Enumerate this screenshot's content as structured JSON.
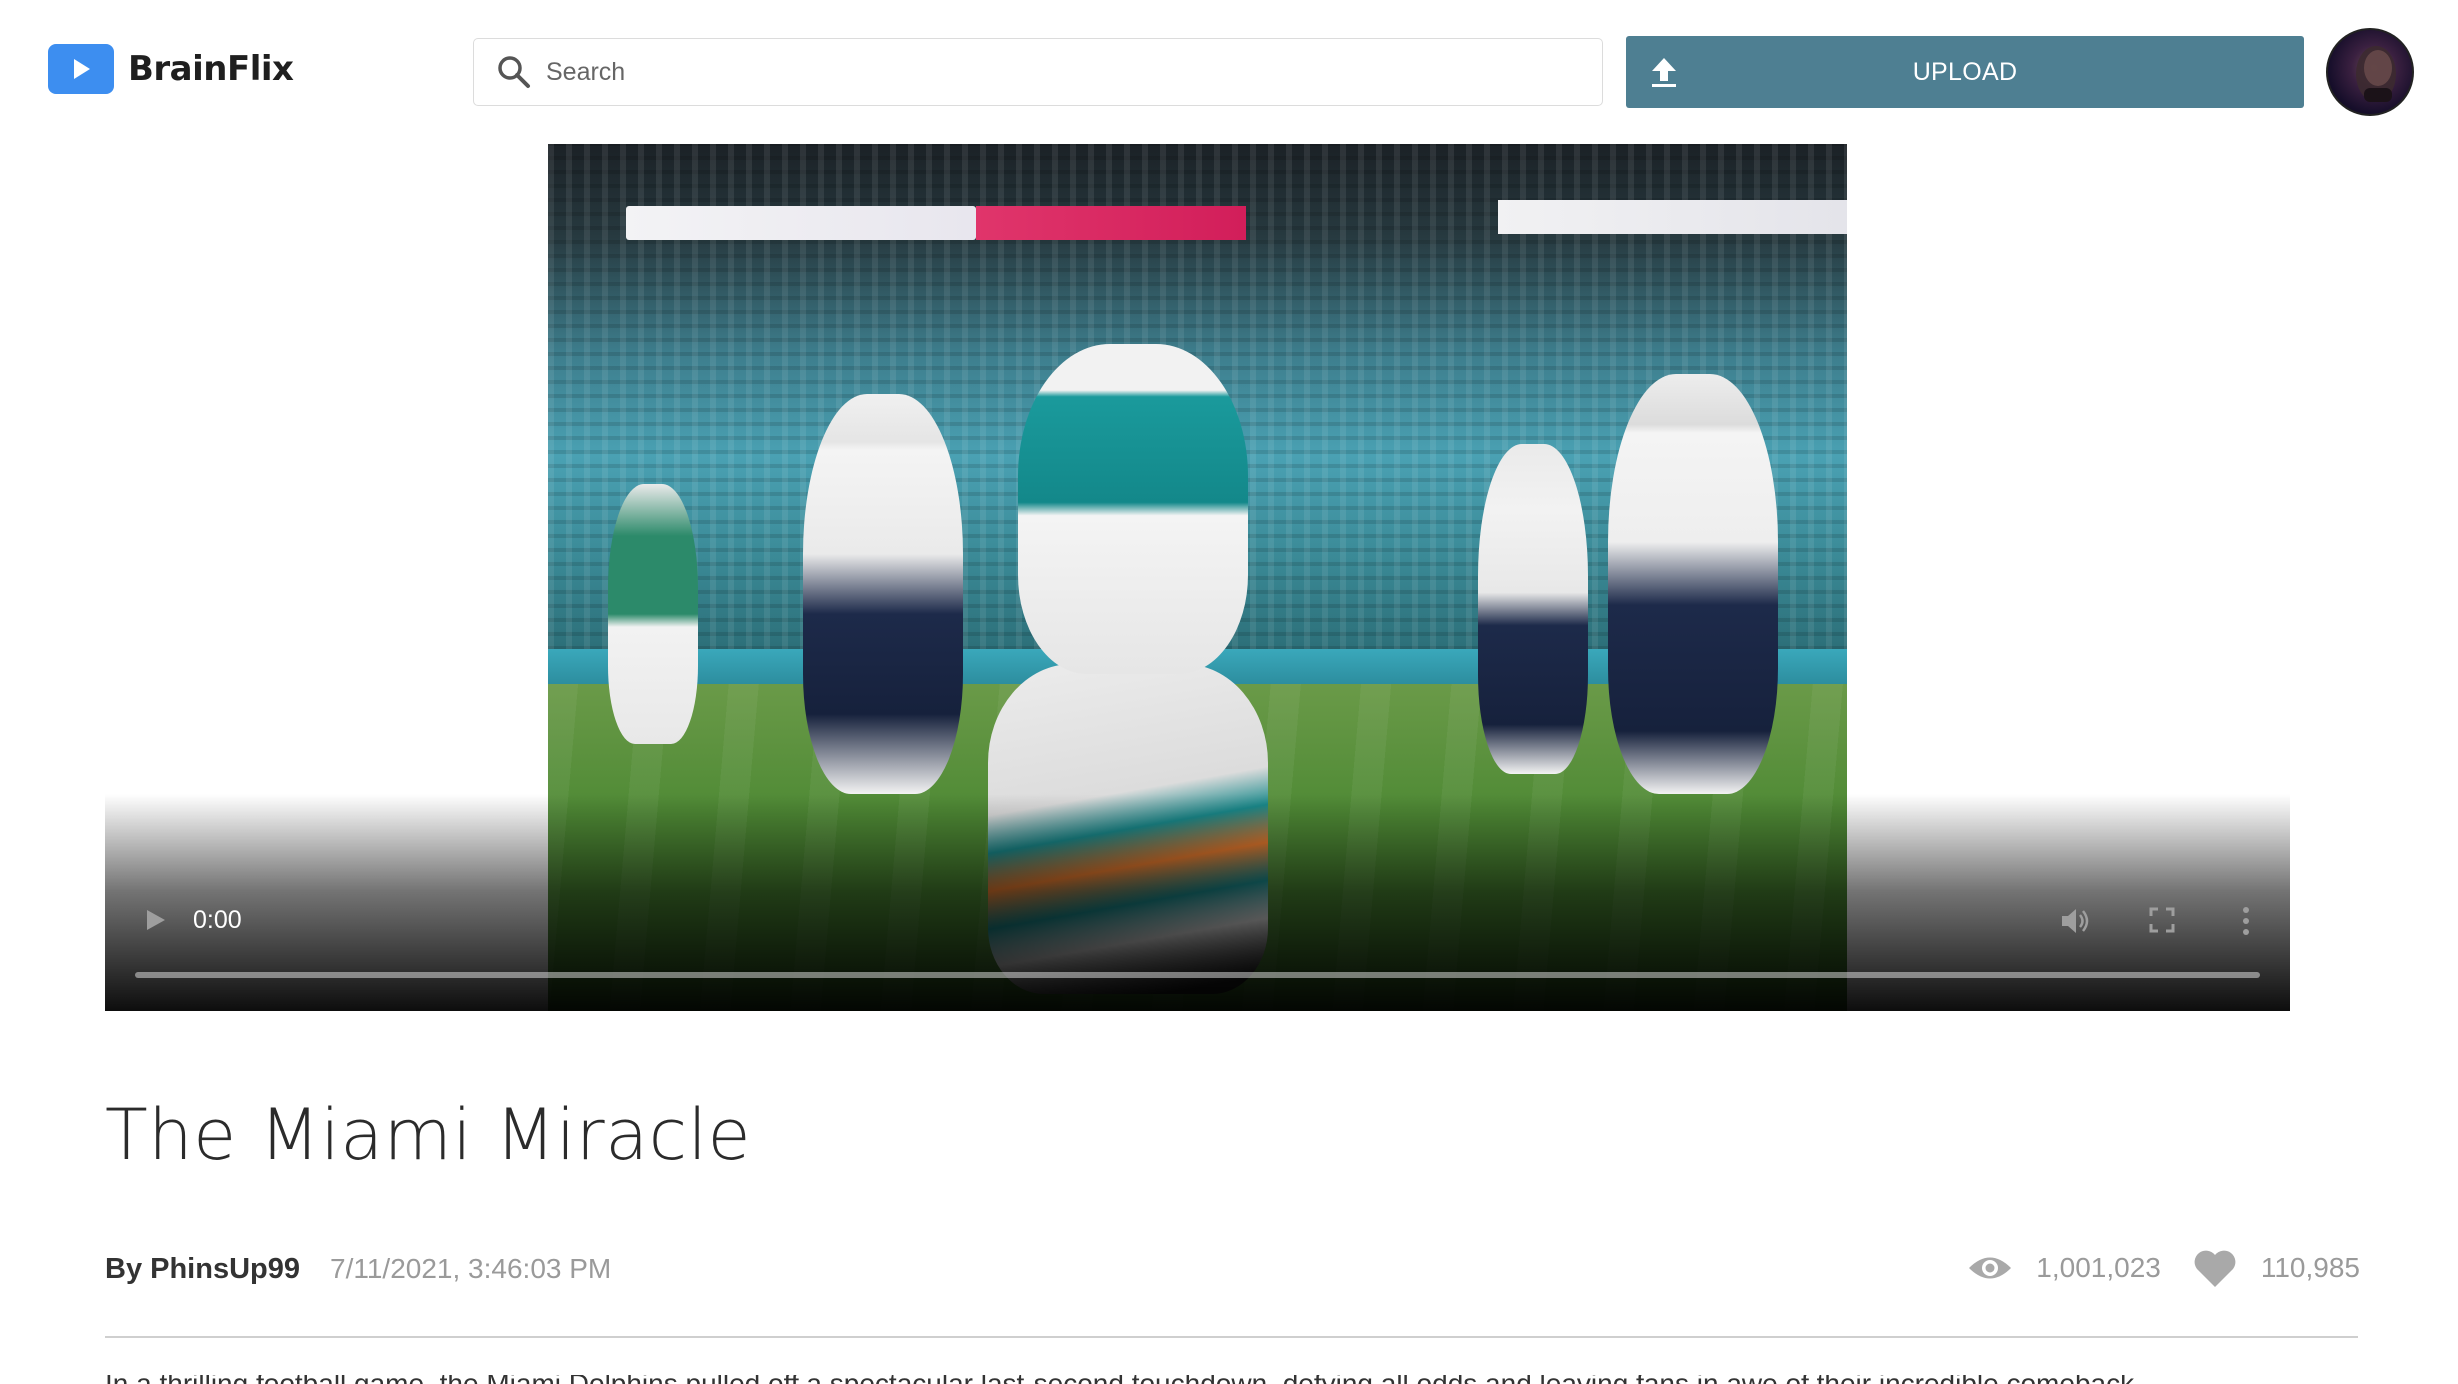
{
  "header": {
    "brand_name": "BrainFlix",
    "search_placeholder": "Search",
    "upload_label": "UPLOAD",
    "icons": {
      "logo": "play-icon",
      "search": "search-icon",
      "upload": "upload-icon"
    }
  },
  "video": {
    "time": "0:00",
    "progress": 0,
    "icons": {
      "play": "play-icon",
      "volume": "volume-icon",
      "fullscreen": "fullscreen-icon",
      "more": "more-vertical-icon"
    }
  },
  "details": {
    "title": "The Miami Miracle",
    "author": "By PhinsUp99",
    "timestamp": "7/11/2021, 3:46:03 PM",
    "views": "1,001,023",
    "likes": "110,985",
    "description": "In a thrilling football game, the Miami Dolphins pulled off a spectacular last-second touchdown, defying all odds and leaving fans in awe of their incredible comeback."
  },
  "colors": {
    "brand_blue": "#3d8ef0",
    "upload_button": "#4e7f92",
    "muted_text": "#9a9a9a"
  }
}
